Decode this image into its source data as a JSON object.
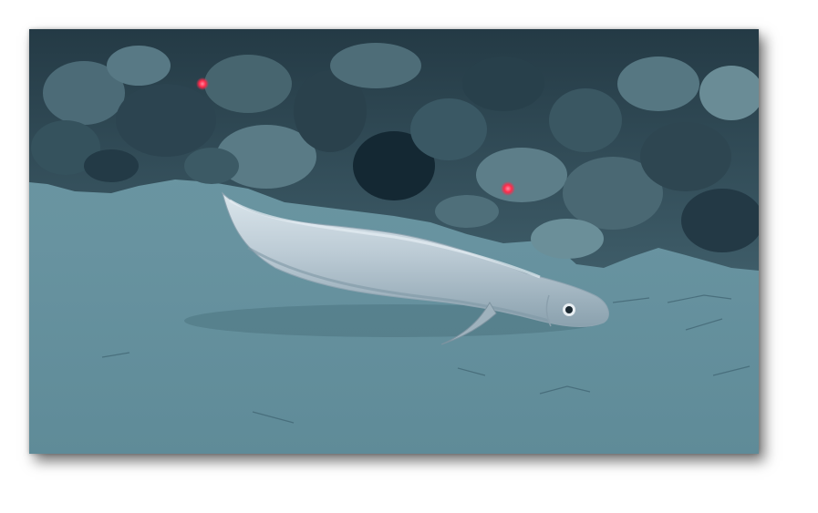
{
  "image": {
    "subject": "fish-on-seafloor",
    "palette": {
      "sediment": "#6e9aa3",
      "sediment_dark": "#55808a",
      "rock_dark": "#1f3440",
      "rock_mid": "#3d5b66",
      "rock_light": "#7fa3ab",
      "fish_body": "#b7c8d2",
      "fish_highlight": "#dce7ee",
      "fish_shadow": "#7f97a5",
      "laser_dot": "#ff2a4a"
    }
  }
}
